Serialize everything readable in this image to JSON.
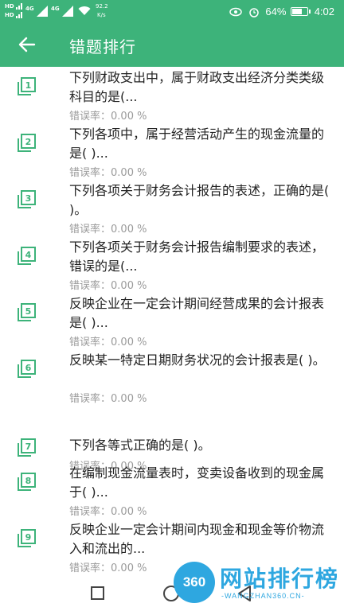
{
  "status_bar": {
    "sim1": "HD",
    "sim2": "HD",
    "network1": "4G",
    "network2": "4G",
    "net_speed_value": "92.2",
    "net_speed_unit": "K/s",
    "battery_percent": "64%",
    "battery_level": 0.64,
    "time": "4:02"
  },
  "app_bar": {
    "title": "错题排行"
  },
  "error_rate_label": "错误率：",
  "items": [
    {
      "rank": "1",
      "title": "下列财政支出中，属于财政支出经济分类类级科目的是(...",
      "rate": "0.00 %"
    },
    {
      "rank": "2",
      "title": "下列各项中，属于经营活动产生的现金流量的是( )...",
      "rate": "0.00 %"
    },
    {
      "rank": "3",
      "title": "下列各项关于财务会计报告的表述，正确的是( )。",
      "rate": "0.00 %"
    },
    {
      "rank": "4",
      "title": "下列各项关于财务会计报告编制要求的表述，错误的是(...",
      "rate": "0.00 %"
    },
    {
      "rank": "5",
      "title": "反映企业在一定会计期间经营成果的会计报表是( )...",
      "rate": "0.00 %"
    },
    {
      "rank": "6",
      "title": "反映某一特定日期财务状况的会计报表是( )。",
      "rate": "0.00 %"
    },
    {
      "rank": "7",
      "title": "下列各等式正确的是( )。",
      "rate": "0.00 %"
    },
    {
      "rank": "8",
      "title": "在编制现金流量表时，变卖设备收到的现金属于( )...",
      "rate": "0.00 %"
    },
    {
      "rank": "9",
      "title": "反映企业一定会计期间内现金和现金等价物流入和流出的...",
      "rate": "0.00 %"
    }
  ],
  "watermark": {
    "badge": "360",
    "title": "网站排行榜",
    "subtitle": "-WANGZHAN360.CN-"
  },
  "colors": {
    "primary": "#3db37a",
    "title_text": "#222222",
    "meta_text": "#9a9a9a",
    "watermark": "#2ea7e0"
  }
}
